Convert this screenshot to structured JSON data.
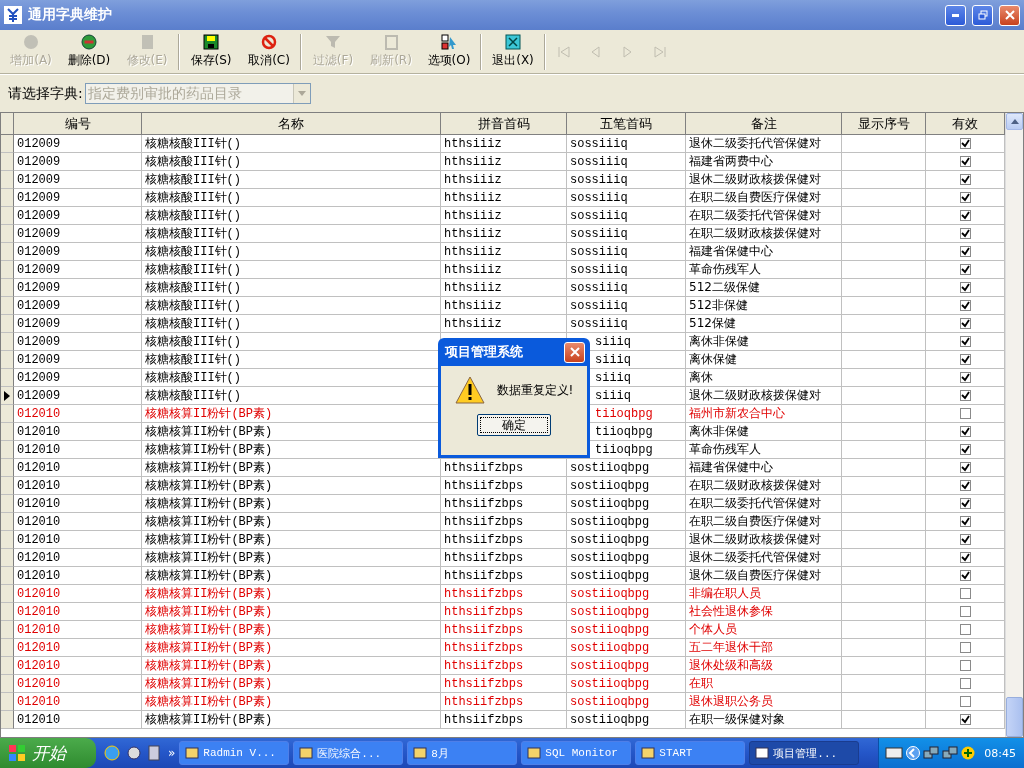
{
  "window": {
    "title": "通用字典维护"
  },
  "toolbar": [
    {
      "kind": "button",
      "label": "增加(A)",
      "disabled": true
    },
    {
      "kind": "button",
      "label": "删除(D)",
      "disabled": false
    },
    {
      "kind": "button",
      "label": "修改(E)",
      "disabled": true
    },
    {
      "kind": "separator"
    },
    {
      "kind": "button",
      "label": "保存(S)",
      "disabled": false
    },
    {
      "kind": "button",
      "label": "取消(C)",
      "disabled": false
    },
    {
      "kind": "separator"
    },
    {
      "kind": "button",
      "label": "过滤(F)",
      "disabled": true
    },
    {
      "kind": "button",
      "label": "刷新(R)",
      "disabled": true
    },
    {
      "kind": "button",
      "label": "选项(O)",
      "disabled": false
    },
    {
      "kind": "separator"
    },
    {
      "kind": "button",
      "label": "退出(X)",
      "disabled": false
    },
    {
      "kind": "separator"
    },
    {
      "kind": "nav",
      "disabled": true
    },
    {
      "kind": "nav",
      "disabled": true
    },
    {
      "kind": "nav",
      "disabled": true
    },
    {
      "kind": "nav",
      "disabled": true
    }
  ],
  "dictionary": {
    "label": "请选择字典:",
    "value": "指定费别审批的药品目录",
    "disabled": true
  },
  "table": {
    "columns": [
      "编号",
      "名称",
      "拼音首码",
      "五笔首码",
      "备注",
      "显示序号",
      "有效"
    ],
    "rows": [
      {
        "code": "012009",
        "name": "核糖核酸III针()",
        "pinyin": "hthsiiiz",
        "wubi": "sossiiiq",
        "note": "退休二级委托代管保健对",
        "checked": true,
        "flagged": false,
        "current": false
      },
      {
        "code": "012009",
        "name": "核糖核酸III针()",
        "pinyin": "hthsiiiz",
        "wubi": "sossiiiq",
        "note": "福建省两费中心",
        "checked": true,
        "flagged": false,
        "current": false
      },
      {
        "code": "012009",
        "name": "核糖核酸III针()",
        "pinyin": "hthsiiiz",
        "wubi": "sossiiiq",
        "note": "退休二级财政核拨保健对",
        "checked": true,
        "flagged": false,
        "current": false
      },
      {
        "code": "012009",
        "name": "核糖核酸III针()",
        "pinyin": "hthsiiiz",
        "wubi": "sossiiiq",
        "note": "在职二级自费医疗保健对",
        "checked": true,
        "flagged": false,
        "current": false
      },
      {
        "code": "012009",
        "name": "核糖核酸III针()",
        "pinyin": "hthsiiiz",
        "wubi": "sossiiiq",
        "note": "在职二级委托代管保健对",
        "checked": true,
        "flagged": false,
        "current": false
      },
      {
        "code": "012009",
        "name": "核糖核酸III针()",
        "pinyin": "hthsiiiz",
        "wubi": "sossiiiq",
        "note": "在职二级财政核拨保健对",
        "checked": true,
        "flagged": false,
        "current": false
      },
      {
        "code": "012009",
        "name": "核糖核酸III针()",
        "pinyin": "hthsiiiz",
        "wubi": "sossiiiq",
        "note": "福建省保健中心",
        "checked": true,
        "flagged": false,
        "current": false
      },
      {
        "code": "012009",
        "name": "核糖核酸III针()",
        "pinyin": "hthsiiiz",
        "wubi": "sossiiiq",
        "note": "革命伤残军人",
        "checked": true,
        "flagged": false,
        "current": false
      },
      {
        "code": "012009",
        "name": "核糖核酸III针()",
        "pinyin": "hthsiiiz",
        "wubi": "sossiiiq",
        "note": "512二级保健",
        "checked": true,
        "flagged": false,
        "current": false
      },
      {
        "code": "012009",
        "name": "核糖核酸III针()",
        "pinyin": "hthsiiiz",
        "wubi": "sossiiiq",
        "note": "512非保健",
        "checked": true,
        "flagged": false,
        "current": false
      },
      {
        "code": "012009",
        "name": "核糖核酸III针()",
        "pinyin": "hthsiiiz",
        "wubi": "sossiiiq",
        "note": "512保健",
        "checked": true,
        "flagged": false,
        "current": false
      },
      {
        "code": "012009",
        "name": "核糖核酸III针()",
        "wubi": "siiiq",
        "note": "离休非保健",
        "checked": true,
        "flagged": false,
        "current": false
      },
      {
        "code": "012009",
        "name": "核糖核酸III针()",
        "wubi": "siiiq",
        "note": "离休保健",
        "checked": true,
        "flagged": false,
        "current": false
      },
      {
        "code": "012009",
        "name": "核糖核酸III针()",
        "wubi": "siiiq",
        "note": "离休",
        "checked": true,
        "flagged": false,
        "current": false
      },
      {
        "code": "012009",
        "name": "核糖核酸III针()",
        "wubi": "siiiq",
        "note": "退休二级财政核拨保健对",
        "checked": true,
        "flagged": false,
        "current": true
      },
      {
        "code": "012010",
        "name": "核糖核算II粉针(BP素)",
        "wubi": "tiioqbpg",
        "note": "福州市新农合中心",
        "checked": false,
        "flagged": true,
        "current": false
      },
      {
        "code": "012010",
        "name": "核糖核算II粉针(BP素)",
        "wubi": "tiioqbpg",
        "note": "离休非保健",
        "checked": true,
        "flagged": false,
        "current": false
      },
      {
        "code": "012010",
        "name": "核糖核算II粉针(BP素)",
        "wubi": "tiioqbpg",
        "note": "革命伤残军人",
        "checked": true,
        "flagged": false,
        "current": false
      },
      {
        "code": "012010",
        "name": "核糖核算II粉针(BP素)",
        "pinyin": "hthsiifzbps",
        "wubi": "sostiioqbpg",
        "note": "福建省保健中心",
        "checked": true,
        "flagged": false,
        "current": false
      },
      {
        "code": "012010",
        "name": "核糖核算II粉针(BP素)",
        "pinyin": "hthsiifzbps",
        "wubi": "sostiioqbpg",
        "note": "在职二级财政核拨保健对",
        "checked": true,
        "flagged": false,
        "current": false
      },
      {
        "code": "012010",
        "name": "核糖核算II粉针(BP素)",
        "pinyin": "hthsiifzbps",
        "wubi": "sostiioqbpg",
        "note": "在职二级委托代管保健对",
        "checked": true,
        "flagged": false,
        "current": false
      },
      {
        "code": "012010",
        "name": "核糖核算II粉针(BP素)",
        "pinyin": "hthsiifzbps",
        "wubi": "sostiioqbpg",
        "note": "在职二级自费医疗保健对",
        "checked": true,
        "flagged": false,
        "current": false
      },
      {
        "code": "012010",
        "name": "核糖核算II粉针(BP素)",
        "pinyin": "hthsiifzbps",
        "wubi": "sostiioqbpg",
        "note": "退休二级财政核拨保健对",
        "checked": true,
        "flagged": false,
        "current": false
      },
      {
        "code": "012010",
        "name": "核糖核算II粉针(BP素)",
        "pinyin": "hthsiifzbps",
        "wubi": "sostiioqbpg",
        "note": "退休二级委托代管保健对",
        "checked": true,
        "flagged": false,
        "current": false
      },
      {
        "code": "012010",
        "name": "核糖核算II粉针(BP素)",
        "pinyin": "hthsiifzbps",
        "wubi": "sostiioqbpg",
        "note": "退休二级自费医疗保健对",
        "checked": true,
        "flagged": false,
        "current": false
      },
      {
        "code": "012010",
        "name": "核糖核算II粉针(BP素)",
        "pinyin": "hthsiifzbps",
        "wubi": "sostiioqbpg",
        "note": "非编在职人员",
        "checked": false,
        "flagged": true,
        "current": false
      },
      {
        "code": "012010",
        "name": "核糖核算II粉针(BP素)",
        "pinyin": "hthsiifzbps",
        "wubi": "sostiioqbpg",
        "note": "社会性退休参保",
        "checked": false,
        "flagged": true,
        "current": false
      },
      {
        "code": "012010",
        "name": "核糖核算II粉针(BP素)",
        "pinyin": "hthsiifzbps",
        "wubi": "sostiioqbpg",
        "note": "个体人员",
        "checked": false,
        "flagged": true,
        "current": false
      },
      {
        "code": "012010",
        "name": "核糖核算II粉针(BP素)",
        "pinyin": "hthsiifzbps",
        "wubi": "sostiioqbpg",
        "note": "五二年退休干部",
        "checked": false,
        "flagged": true,
        "current": false
      },
      {
        "code": "012010",
        "name": "核糖核算II粉针(BP素)",
        "pinyin": "hthsiifzbps",
        "wubi": "sostiioqbpg",
        "note": "退休处级和高级",
        "checked": false,
        "flagged": true,
        "current": false
      },
      {
        "code": "012010",
        "name": "核糖核算II粉针(BP素)",
        "pinyin": "hthsiifzbps",
        "wubi": "sostiioqbpg",
        "note": "在职",
        "checked": false,
        "flagged": true,
        "current": false
      },
      {
        "code": "012010",
        "name": "核糖核算II粉针(BP素)",
        "pinyin": "hthsiifzbps",
        "wubi": "sostiioqbpg",
        "note": "退休退职公务员",
        "checked": false,
        "flagged": true,
        "current": false
      },
      {
        "code": "012010",
        "name": "核糖核算II粉针(BP素)",
        "pinyin": "hthsiifzbps",
        "wubi": "sostiioqbpg",
        "note": "在职一级保健对象",
        "checked": true,
        "flagged": false,
        "current": false
      }
    ]
  },
  "dialog": {
    "title": "项目管理系统",
    "message": "数据重复定义!",
    "button": "确定"
  },
  "taskbar": {
    "start": "开始",
    "more": "»",
    "tasks": [
      {
        "label": "Radmin V...",
        "selected": false
      },
      {
        "label": "医院综合...",
        "selected": false
      },
      {
        "label": "8月",
        "selected": false
      },
      {
        "label": "SQL Monitor",
        "selected": false
      },
      {
        "label": "START",
        "selected": false
      },
      {
        "label": "项目管理...",
        "selected": true
      }
    ],
    "clock": "08:45"
  }
}
